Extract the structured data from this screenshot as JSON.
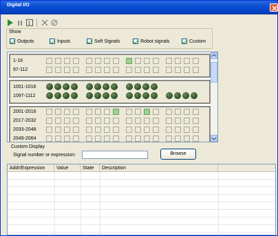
{
  "window": {
    "title": "Digital I/O"
  },
  "toolbar": {
    "icons": [
      "play-icon",
      "pause-icon",
      "step-icon",
      "clear-icon",
      "erase-icon"
    ]
  },
  "show": {
    "label": "Show",
    "options": [
      {
        "label": "Outputs",
        "checked": true
      },
      {
        "label": "Inputs",
        "checked": true
      },
      {
        "label": "Soft Signals",
        "checked": true
      },
      {
        "label": "Robot signals",
        "checked": true
      },
      {
        "label": "Custom",
        "checked": true
      }
    ]
  },
  "outputs": {
    "rows": [
      {
        "label": "1-16",
        "on": [
          8
        ]
      },
      {
        "label": "97-112",
        "on": []
      }
    ]
  },
  "robot": {
    "rows": [
      {
        "label": "1001-1016",
        "count": 12
      },
      {
        "label": "1097-1112",
        "count": 16
      }
    ]
  },
  "soft": {
    "rows": [
      {
        "label": "2001-2016",
        "on": [
          7,
          10
        ]
      },
      {
        "label": "2017-2032",
        "on": []
      },
      {
        "label": "2033-2048",
        "on": []
      },
      {
        "label": "2049-2064",
        "on": []
      }
    ]
  },
  "custom": {
    "label": "Custom Display",
    "signal_label": "Signal number or expression:",
    "signal_value": "",
    "browse_label": "Browse"
  },
  "table": {
    "columns": [
      "Addr/Expression",
      "Value",
      "State",
      "Description"
    ]
  },
  "colors": {
    "title_bar": "#0a4fd4",
    "signal_on": "#9ed08e",
    "led": "#2c4a22"
  }
}
